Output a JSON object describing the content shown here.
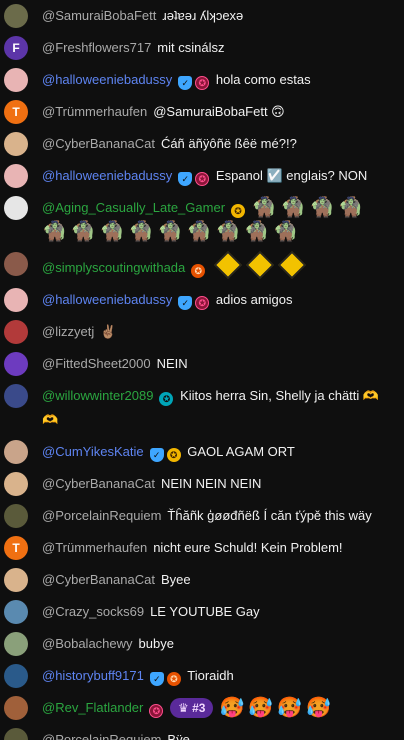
{
  "messages": [
    {
      "author": "@SamuraiBobaFett",
      "text": "ɹǝʇɐǝɹ ʎlʞɔexǝ",
      "avatar": {
        "type": "image",
        "color": "#6b6b4a"
      },
      "author_color": "grey"
    },
    {
      "author": "@Freshflowers717",
      "text": "mit csinálsz",
      "avatar": {
        "type": "letter",
        "letter": "F",
        "color": "#5c35a8"
      },
      "author_color": "grey"
    },
    {
      "author": "@halloweeniebadussy",
      "text": "hola como estas",
      "avatar": {
        "type": "image",
        "color": "#e8b4b4"
      },
      "author_color": "blue",
      "badges": [
        "shield",
        "pink"
      ]
    },
    {
      "author": "@Trümmerhaufen",
      "text": "@SamuraiBobaFett 🙃",
      "avatar": {
        "type": "letter",
        "letter": "T",
        "color": "#f07012"
      },
      "author_color": "grey"
    },
    {
      "author": "@CyberBananaCat",
      "text": "Ćáñ äñÿôñë ßêë mé?!?",
      "avatar": {
        "type": "image",
        "color": "#d9b38c"
      },
      "author_color": "grey"
    },
    {
      "author": "@halloweeniebadussy",
      "text": "Espanol ☑️ englais? NON",
      "avatar": {
        "type": "image",
        "color": "#e8b4b4"
      },
      "author_color": "blue",
      "badges": [
        "shield",
        "pink"
      ]
    },
    {
      "author": "@Aging_Casually_Late_Gamer",
      "text": "",
      "avatar": {
        "type": "image",
        "color": "#e6e6e6"
      },
      "author_color": "green",
      "badges": [
        "gold"
      ],
      "emotes": [
        "🧌",
        "🧌",
        "🧌",
        "🧌",
        "🧌",
        "🧌",
        "🧌",
        "🧌",
        "🧌",
        "🧌",
        "🧌",
        "🧌",
        "🧌"
      ]
    },
    {
      "author": "@simplyscoutingwithada",
      "text": "",
      "avatar": {
        "type": "image",
        "color": "#8a5a4a"
      },
      "author_color": "green",
      "badges": [
        "orange"
      ],
      "signs": 3
    },
    {
      "author": "@halloweeniebadussy",
      "text": "adios amigos",
      "avatar": {
        "type": "image",
        "color": "#e8b4b4"
      },
      "author_color": "blue",
      "badges": [
        "shield",
        "pink"
      ]
    },
    {
      "author": "@lizzyetj",
      "text": "✌🏽",
      "avatar": {
        "type": "image",
        "color": "#b23a3a"
      },
      "author_color": "grey"
    },
    {
      "author": "@FittedSheet2000",
      "text": "NEIN",
      "avatar": {
        "type": "image",
        "color": "#6d3bbf"
      },
      "author_color": "grey"
    },
    {
      "author": "@willowwinter2089",
      "text": "Kiitos herra Sin, Shelly ja chätti 🫶 🫶",
      "avatar": {
        "type": "image",
        "color": "#3a4a8a"
      },
      "author_color": "green",
      "badges": [
        "cyan"
      ]
    },
    {
      "author": "@CumYikesKatie",
      "text": "GAOL AGAM ORT",
      "avatar": {
        "type": "image",
        "color": "#c9a48a"
      },
      "author_color": "blue",
      "badges": [
        "shield",
        "gold"
      ]
    },
    {
      "author": "@CyberBananaCat",
      "text": "NEIN NEIN NEIN",
      "avatar": {
        "type": "image",
        "color": "#d9b38c"
      },
      "author_color": "grey"
    },
    {
      "author": "@PorcelainRequiem",
      "text": "Ťĥăñk ģøøđñëß Í căn ťýpě this wäy",
      "avatar": {
        "type": "image",
        "color": "#5a5a3a"
      },
      "author_color": "grey"
    },
    {
      "author": "@Trümmerhaufen",
      "text": "nicht eure Schuld! Kein Problem!",
      "avatar": {
        "type": "letter",
        "letter": "T",
        "color": "#f07012"
      },
      "author_color": "grey"
    },
    {
      "author": "@CyberBananaCat",
      "text": "Byee",
      "avatar": {
        "type": "image",
        "color": "#d9b38c"
      },
      "author_color": "grey"
    },
    {
      "author": "@Crazy_socks69",
      "text": "LE YOUTUBE Gay",
      "avatar": {
        "type": "image",
        "color": "#5a8ab0"
      },
      "author_color": "grey"
    },
    {
      "author": "@Bobalachewy",
      "text": "bubye",
      "avatar": {
        "type": "image",
        "color": "#8aa07a"
      },
      "author_color": "grey"
    },
    {
      "author": "@historybuff9171",
      "text": "Tioraidh",
      "avatar": {
        "type": "image",
        "color": "#2a5a8a"
      },
      "author_color": "blue",
      "badges": [
        "shield",
        "orange"
      ]
    },
    {
      "author": "@Rev_Flatlander",
      "text": "",
      "avatar": {
        "type": "image",
        "color": "#a0603a"
      },
      "author_color": "green",
      "badges": [
        "pink"
      ],
      "rank": "♛ #3",
      "emotes": [
        "🥵",
        "🥵",
        "🥵",
        "🥵"
      ]
    },
    {
      "author": "@PorcelainRequiem",
      "text": "Bÿe",
      "avatar": {
        "type": "image",
        "color": "#5a5a3a"
      },
      "author_color": "grey"
    }
  ]
}
